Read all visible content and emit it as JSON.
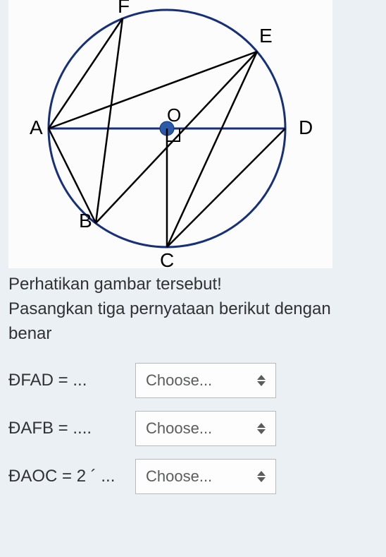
{
  "figure": {
    "points": {
      "A": "A",
      "B": "B",
      "C": "C",
      "D": "D",
      "E": "E",
      "F": "F",
      "O": "O"
    }
  },
  "question": {
    "line1": "Perhatikan gambar tersebut!",
    "line2": "Pasangkan tiga pernyataan berikut dengan benar"
  },
  "rows": [
    {
      "label": "ĐFAD = ...",
      "placeholder": "Choose..."
    },
    {
      "label": "ĐAFB = ....",
      "placeholder": "Choose..."
    },
    {
      "label": "ĐAOC = 2 ´ ...",
      "placeholder": "Choose..."
    }
  ]
}
